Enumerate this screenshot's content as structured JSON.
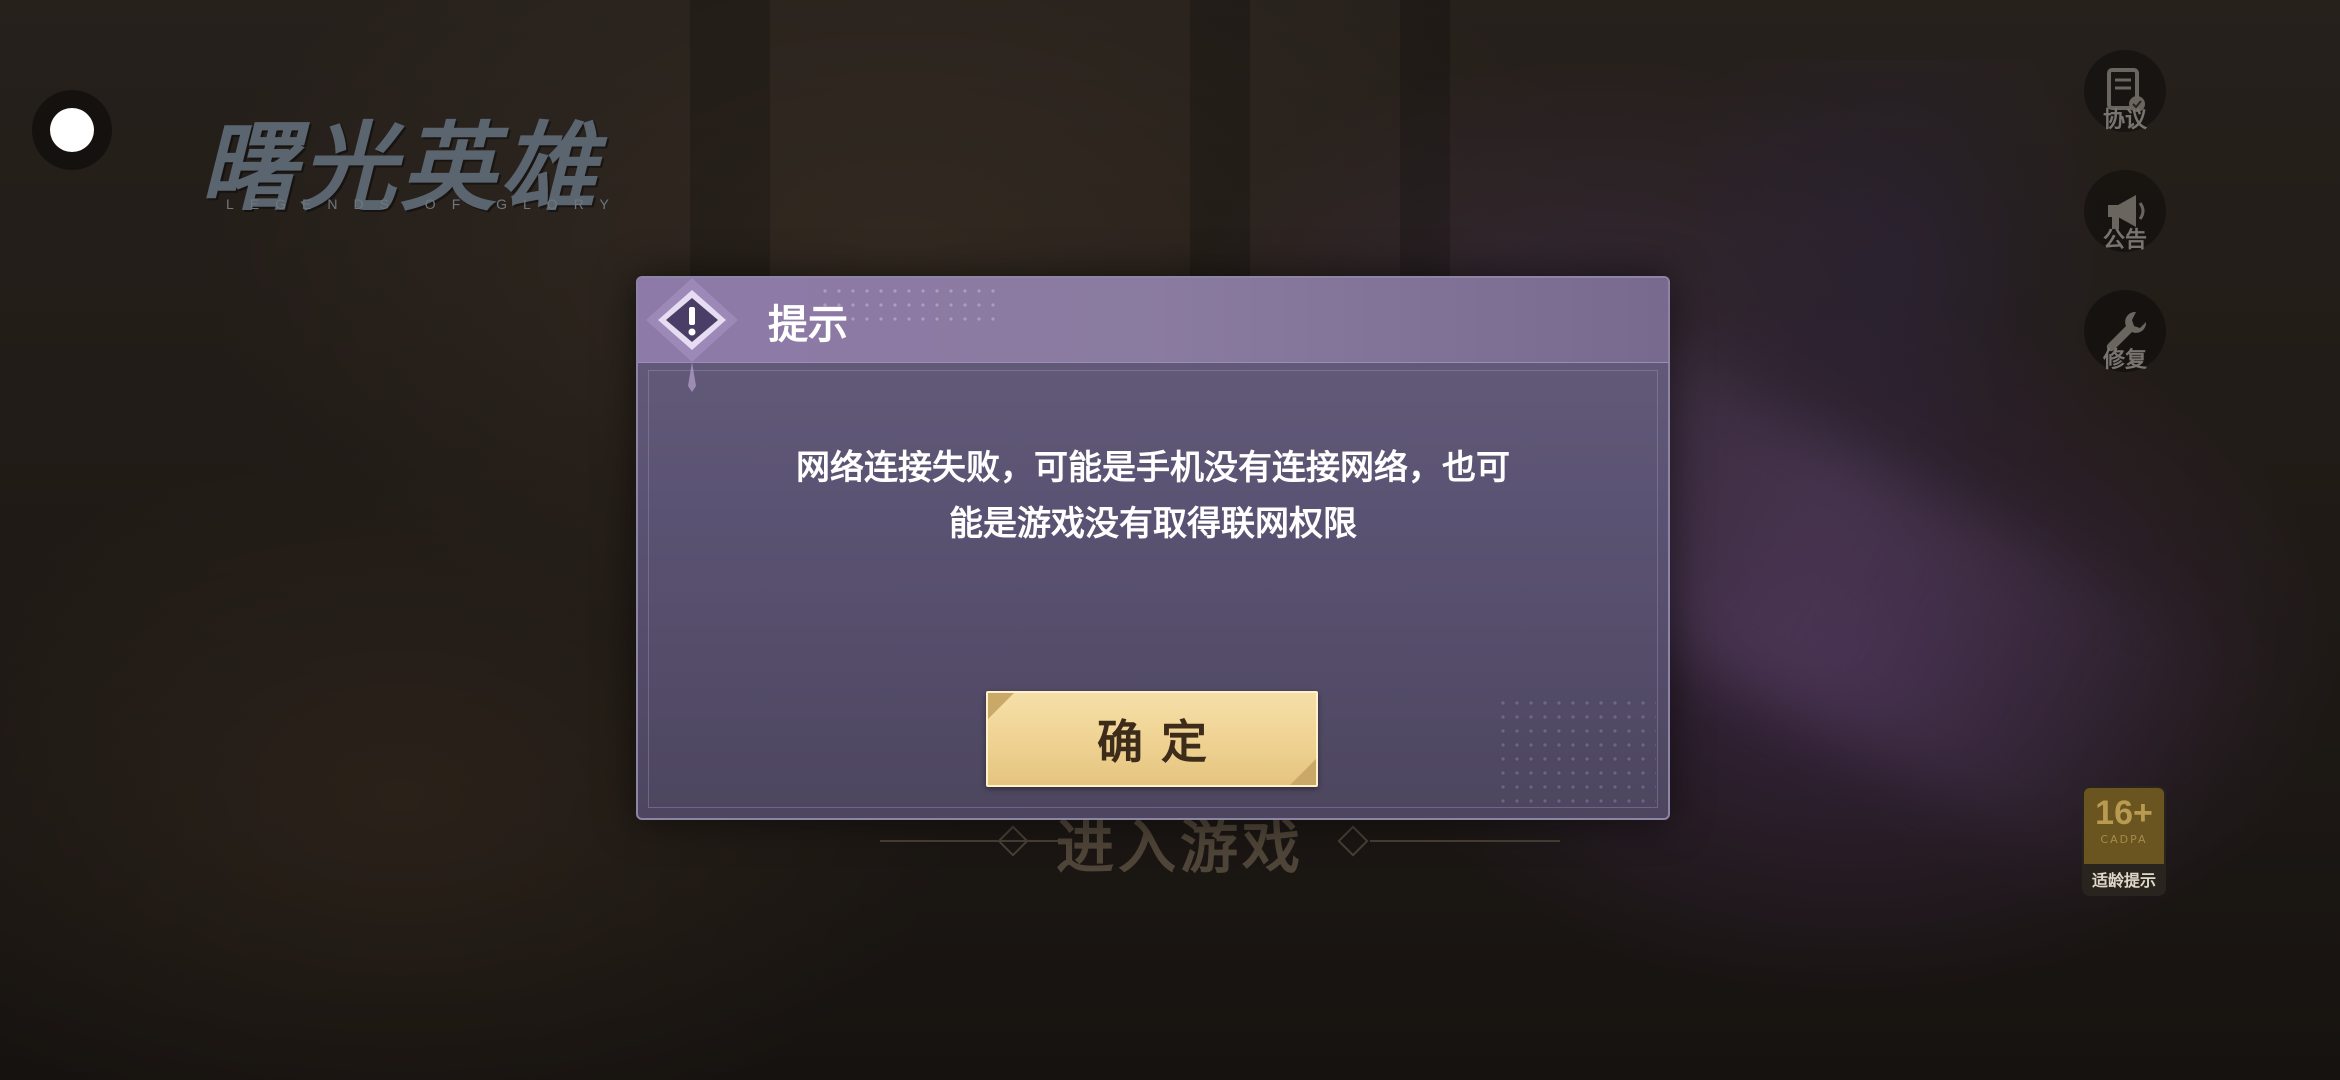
{
  "game": {
    "logo_cn": "曙光英雄",
    "logo_en": "LEGENDS OF GLORY"
  },
  "side_menu": [
    {
      "icon": "document-check-icon",
      "label": "协议"
    },
    {
      "icon": "megaphone-icon",
      "label": "公告"
    },
    {
      "icon": "wrench-icon",
      "label": "修复"
    }
  ],
  "age_rating": {
    "value": "16+",
    "org": "CADPA",
    "label": "适龄提示"
  },
  "enter_game": "进入游戏",
  "dialog": {
    "title": "提示",
    "message_line1": "网络连接失败，可能是手机没有连接网络，也可",
    "message_line2": "能是游戏没有取得联网权限",
    "confirm_label": "确定"
  },
  "colors": {
    "dialog_bg": "#5a5272",
    "dialog_header": "#8a7ba0",
    "button_gold": "#efd292",
    "button_text": "#3e2c1a"
  }
}
